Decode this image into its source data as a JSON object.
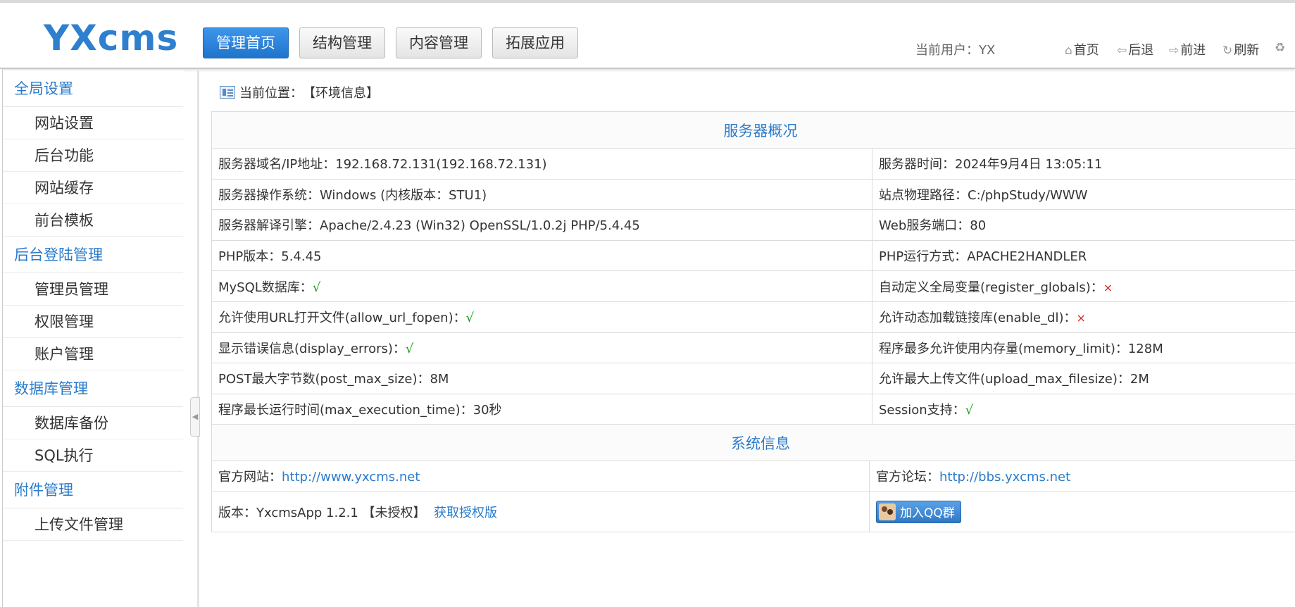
{
  "header": {
    "logo": "YXcms",
    "nav": [
      {
        "label": "管理首页",
        "active": true
      },
      {
        "label": "结构管理",
        "active": false
      },
      {
        "label": "内容管理",
        "active": false
      },
      {
        "label": "拓展应用",
        "active": false
      }
    ],
    "current_user": "当前用户：YX",
    "quick_links": [
      {
        "icon": "home-icon",
        "label": "首页"
      },
      {
        "icon": "back-arrow-icon",
        "label": "后退"
      },
      {
        "icon": "forward-arrow-icon",
        "label": "前进"
      },
      {
        "icon": "refresh-icon",
        "label": "刷新"
      }
    ]
  },
  "sidebar": {
    "groups": [
      {
        "title": "全局设置",
        "items": [
          "网站设置",
          "后台功能",
          "网站缓存",
          "前台模板"
        ]
      },
      {
        "title": "后台登陆管理",
        "items": [
          "管理员管理",
          "权限管理",
          "账户管理"
        ]
      },
      {
        "title": "数据库管理",
        "items": [
          "数据库备份",
          "SQL执行"
        ]
      },
      {
        "title": "附件管理",
        "items": [
          "上传文件管理"
        ]
      }
    ]
  },
  "location": {
    "label": "当前位置：",
    "value": "【环境信息】"
  },
  "server": {
    "title": "服务器概况",
    "rows": [
      {
        "l": "服务器域名/IP地址：192.168.72.131(192.168.72.131)",
        "r": "服务器时间：2024年9月4日 13:05:11"
      },
      {
        "l": "服务器操作系统：Windows (内核版本：STU1)",
        "r": "站点物理路径：C:/phpStudy/WWW"
      },
      {
        "l": "服务器解译引擎：Apache/2.4.23 (Win32) OpenSSL/1.0.2j PHP/5.4.45",
        "r": "Web服务端口：80"
      },
      {
        "l": "PHP版本：5.4.45",
        "r": "PHP运行方式：APACHE2HANDLER"
      },
      {
        "l": "MySQL数据库：",
        "l_mark": "√",
        "r": "自动定义全局变量(register_globals)：",
        "r_mark": "×"
      },
      {
        "l": "允许使用URL打开文件(allow_url_fopen)：",
        "l_mark": "√",
        "r": "允许动态加载链接库(enable_dl)：",
        "r_mark": "×"
      },
      {
        "l": "显示错误信息(display_errors)：",
        "l_mark": "√",
        "r": "程序最多允许使用内存量(memory_limit)：128M"
      },
      {
        "l": "POST最大字节数(post_max_size)：8M",
        "r": "允许最大上传文件(upload_max_filesize)：2M"
      },
      {
        "l": "程序最长运行时间(max_execution_time)：30秒",
        "r": "Session支持：",
        "r_mark": "√"
      }
    ]
  },
  "system": {
    "title": "系统信息",
    "site_label": "官方网站：",
    "site_link": "http://www.yxcms.net",
    "forum_label": "官方论坛：",
    "forum_link": "http://bbs.yxcms.net",
    "version_label": "版本：YxcmsApp 1.2.1 【未授权】",
    "license_link": "获取授权版",
    "qq_button": "加入QQ群"
  }
}
